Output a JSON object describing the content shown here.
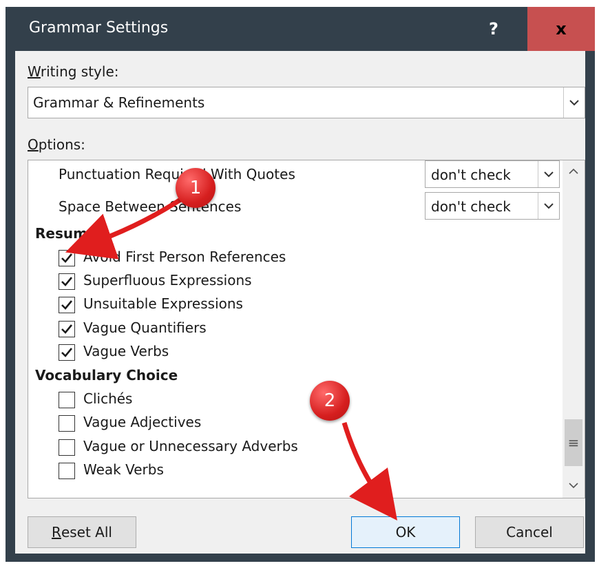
{
  "window": {
    "title": "Grammar Settings",
    "help_label": "?",
    "close_label": "x"
  },
  "writing_style": {
    "label_underlined": "W",
    "label_rest": "riting style:",
    "value": "Grammar & Refinements"
  },
  "options": {
    "label_underlined": "O",
    "label_rest": "ptions:",
    "select_rows": [
      {
        "label": "Punctuation Required With Quotes",
        "value": "don't check"
      },
      {
        "label": "Space Between Sentences",
        "value": "don't check"
      }
    ],
    "categories": [
      {
        "name": "Resume",
        "items": [
          {
            "label": "Avoid First Person References",
            "checked": true
          },
          {
            "label": "Superfluous Expressions",
            "checked": true
          },
          {
            "label": "Unsuitable Expressions",
            "checked": true
          },
          {
            "label": "Vague Quantifiers",
            "checked": true
          },
          {
            "label": "Vague Verbs",
            "checked": true
          }
        ]
      },
      {
        "name": "Vocabulary Choice",
        "items": [
          {
            "label": "Clichés",
            "checked": false
          },
          {
            "label": "Vague Adjectives",
            "checked": false
          },
          {
            "label": "Vague or Unnecessary Adverbs",
            "checked": false
          },
          {
            "label": "Weak Verbs",
            "checked": false
          }
        ]
      }
    ]
  },
  "buttons": {
    "reset_underlined": "R",
    "reset_rest": "eset All",
    "ok": "OK",
    "cancel": "Cancel"
  },
  "annotations": {
    "callout_1": "1",
    "callout_2": "2"
  },
  "colors": {
    "titlebar": "#33404b",
    "close": "#c75050",
    "callout": "#d61f1f",
    "dialog_bg": "#f0f0f0"
  }
}
